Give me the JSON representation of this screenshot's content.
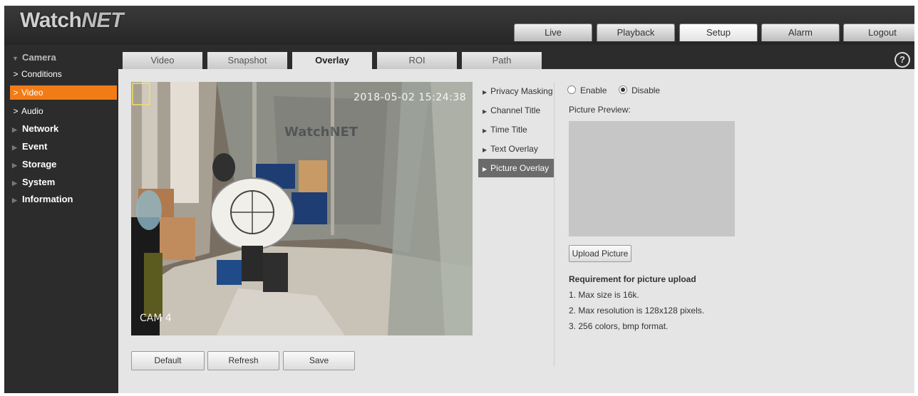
{
  "brand": {
    "logo_part1": "Watch",
    "logo_part2": "NET"
  },
  "nav": {
    "items": [
      {
        "label": "Live"
      },
      {
        "label": "Playback"
      },
      {
        "label": "Setup",
        "active": true
      },
      {
        "label": "Alarm"
      },
      {
        "label": "Logout"
      }
    ]
  },
  "sidebar": {
    "camera": "Camera",
    "conditions": "Conditions",
    "video": "Video",
    "audio": "Audio",
    "network": "Network",
    "event": "Event",
    "storage": "Storage",
    "system": "System",
    "information": "Information",
    "selected": "Video"
  },
  "tabs": [
    {
      "label": "Video"
    },
    {
      "label": "Snapshot"
    },
    {
      "label": "Overlay",
      "active": true
    },
    {
      "label": "ROI"
    },
    {
      "label": "Path"
    }
  ],
  "help_icon": "?",
  "video": {
    "timestamp": "2018-05-02 15:24:38",
    "cam_label": "CAM 4",
    "watermark": "WatchNET"
  },
  "buttons": {
    "default": "Default",
    "refresh": "Refresh",
    "save": "Save"
  },
  "overlay_menu": [
    {
      "label": "Privacy Masking"
    },
    {
      "label": "Channel Title"
    },
    {
      "label": "Time Title"
    },
    {
      "label": "Text Overlay"
    },
    {
      "label": "Picture Overlay",
      "active": true
    }
  ],
  "panel": {
    "enable_label": "Enable",
    "disable_label": "Disable",
    "enabled": false,
    "preview_label": "Picture Preview:",
    "upload_button": "Upload Picture",
    "req_title": "Requirement for picture upload",
    "req1": "1. Max size is 16k.",
    "req2": "2. Max resolution is 128x128 pixels.",
    "req3": "3. 256 colors, bmp format."
  },
  "colors": {
    "accent": "#f17c17",
    "background": "#2c2c2c",
    "panel": "#e5e5e5",
    "active_menu": "#6b6b6b"
  }
}
